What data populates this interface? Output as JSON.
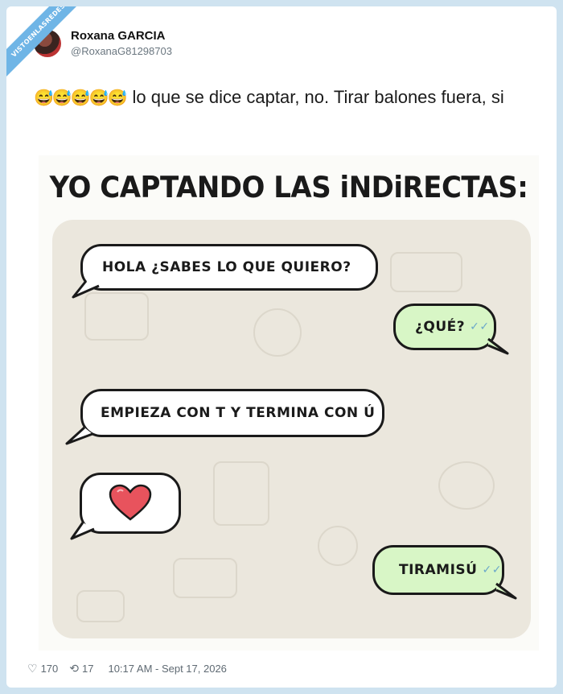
{
  "watermark": {
    "text": "VISTOENLASREDES"
  },
  "author": {
    "display_name": "Roxana GARCIA",
    "handle": "@RoxanaG81298703"
  },
  "tweet": {
    "emoji": "😅😅😅😅😅",
    "text": "lo que se dice captar, no. Tirar balones fuera, si"
  },
  "meme": {
    "title": "YO CAPTANDO LAS iNDiRECTAS:",
    "messages": [
      {
        "side": "in",
        "text": "HOLA ¿SABES LO QUE QUIERO?"
      },
      {
        "side": "out",
        "text": "¿QUÉ?"
      },
      {
        "side": "in",
        "text": "EMPIEZA CON T Y TERMINA CON Ú"
      },
      {
        "side": "in",
        "text": "",
        "icon": "heart-icon"
      },
      {
        "side": "out",
        "text": "TIRAMISÚ"
      }
    ]
  },
  "stats": {
    "likes": "170",
    "retweets": "17",
    "timestamp": "10:17 AM - Sept 17, 2026"
  },
  "colors": {
    "background": "#cfe3f0",
    "incoming_bubble": "#ffffff",
    "outgoing_bubble": "#d8f6c6",
    "heart": "#e8535d",
    "chat_background": "#ebe7dd"
  }
}
